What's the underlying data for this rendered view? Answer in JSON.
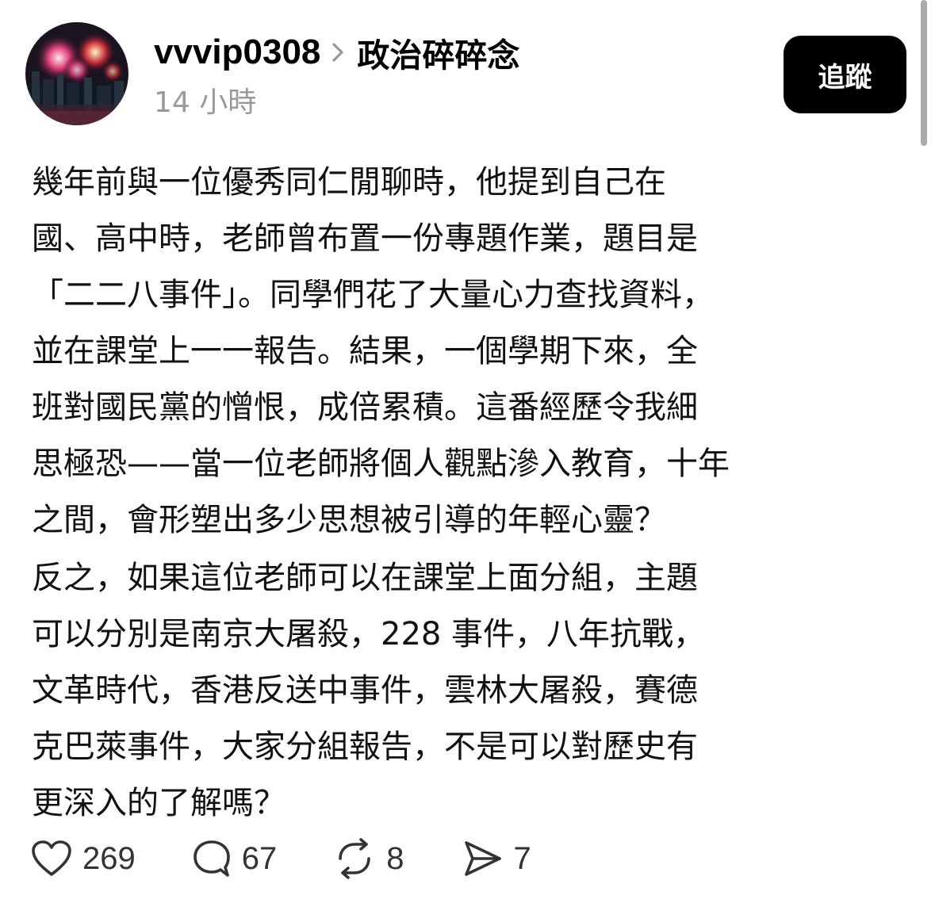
{
  "post": {
    "username": "vvvip0308",
    "topic": "政治碎碎念",
    "time": "14 小時",
    "follow_label": "追蹤",
    "paragraphs": [
      [
        "幾年前與一位優秀同仁閒聊時，他提到自己在",
        "國、高中時，老師曾布置一份專題作業，題目是",
        "「二二八事件」。同學們花了大量心力查找資料，",
        "並在課堂上一一報告。結果，一個學期下來，全",
        "班對國民黨的憎恨，成倍累積。這番經歷令我細",
        "思極恐——當一位老師將個人觀點滲入教育，十年",
        "之間，會形塑出多少思想被引導的年輕心靈？"
      ],
      [
        "反之，如果這位老師可以在課堂上面分組，主題",
        "可以分別是南京大屠殺，228 事件，八年抗戰，",
        "文革時代，香港反送中事件，雲林大屠殺，賽德",
        "克巴萊事件，大家分組報告，不是可以對歷史有",
        "更深入的了解嗎？"
      ]
    ]
  },
  "actions": {
    "like_count": "269",
    "comment_count": "67",
    "repost_count": "8",
    "share_count": "7"
  },
  "icons": {
    "like": "heart-icon",
    "comment": "comment-bubble-icon",
    "repost": "repost-icon",
    "share": "send-icon"
  },
  "colors": {
    "follow_button_bg": "#000000",
    "timestamp": "#999999"
  }
}
